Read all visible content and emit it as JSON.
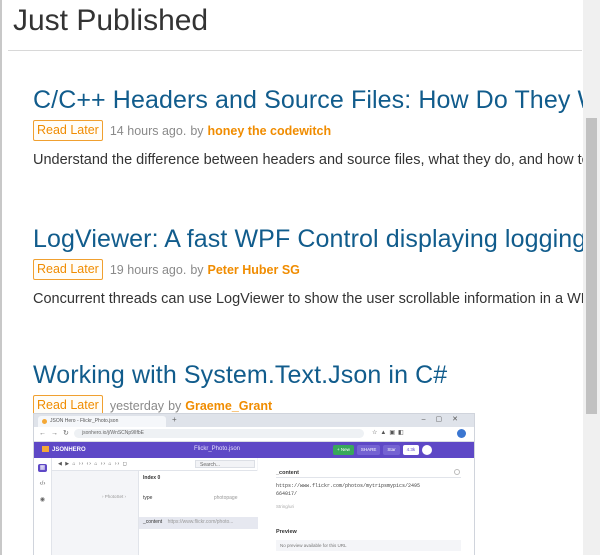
{
  "section": {
    "title": "Just Published"
  },
  "articles": [
    {
      "title": "C/C++ Headers and Source Files: How Do They Work?",
      "read_later": "Read Later",
      "age": "14 hours ago.",
      "by": "by",
      "author": "honey the codewitch",
      "summary": "Understand the difference between headers and source files, what they do, and how to use them."
    },
    {
      "title": "LogViewer: A fast WPF Control displaying logging information",
      "read_later": "Read Later",
      "age": "19 hours ago.",
      "by": "by",
      "author": "Peter Huber SG",
      "summary": "Concurrent threads can use LogViewer to show the user scrollable information in a WPF application."
    },
    {
      "title": "Working with System.Text.Json in C#",
      "read_later": "Read Later",
      "age": "yesterday",
      "by": "by",
      "author": "Graeme_Grant"
    }
  ],
  "embedded_screenshot": {
    "tab_title": "JSON Hero - Flickr_Photo.json",
    "url": "jsonhero.io/j/WnSCNp9lIfbE",
    "logo": "JSONHERO",
    "doc_title": "Flickr_Photo.json",
    "buttons": [
      "+ New",
      "SHARE",
      "Star",
      "4.3k"
    ],
    "search": "Search...",
    "tree": {
      "index": "Index 0",
      "type_row_key": "type",
      "type_row_value": "photopage",
      "content_row_key": "_content",
      "content_row_value": "https://www.flickr.com/photo...",
      "preview_label": "Preview"
    },
    "detail": {
      "title": "_content",
      "value_line1": "https://www.flickr.com/photos/mytripsmypics/2495",
      "value_line2": "664017/",
      "type": "String/uri",
      "preview_title": "Preview",
      "preview_note": "No preview available for this URL"
    }
  },
  "colors": {
    "link_title": "#115c8c",
    "accent_orange": "#f08c00",
    "app_purple": "#5e48c6"
  }
}
